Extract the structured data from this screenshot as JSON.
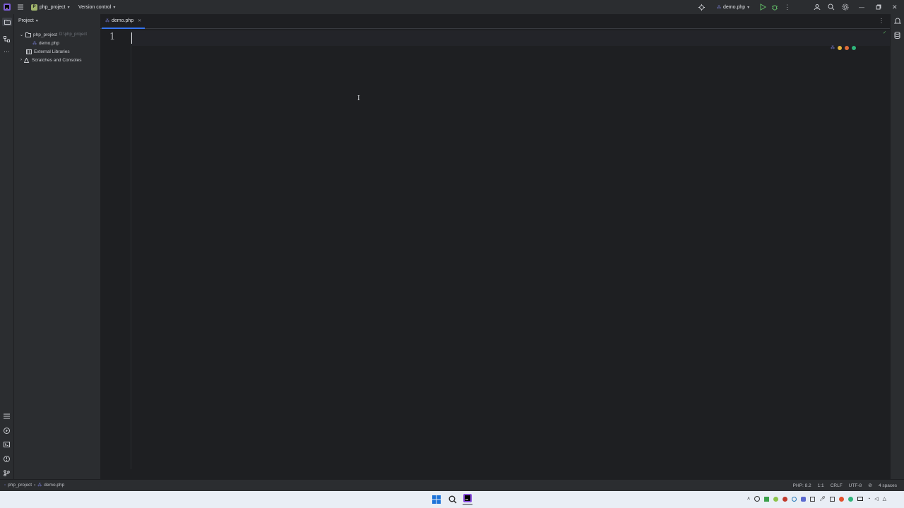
{
  "titlebar": {
    "project_name": "php_project",
    "project_badge": "P",
    "version_control": "Version control",
    "run_config": "demo.php",
    "colors": {
      "badge": "#a1b56c"
    }
  },
  "project_panel": {
    "title": "Project",
    "tree": [
      {
        "label": "php_project",
        "path": "D:\\php_project"
      },
      {
        "label": "demo.php"
      },
      {
        "label": "External Libraries"
      },
      {
        "label": "Scratches and Consoles"
      }
    ]
  },
  "tabs": [
    {
      "label": "demo.php",
      "icon": "php-file-icon",
      "active": true
    }
  ],
  "editor": {
    "line_numbers": [
      "1"
    ],
    "content": ""
  },
  "statusbar": {
    "breadcrumb": [
      "php_project",
      "demo.php"
    ],
    "php_version": "PHP: 8.2",
    "position": "1:1",
    "line_separator": "CRLF",
    "encoding": "UTF-8",
    "indent": "4 spaces"
  },
  "colors": {
    "accent": "#3574f0",
    "bg": "#1e1f22",
    "panel": "#2b2d30"
  }
}
